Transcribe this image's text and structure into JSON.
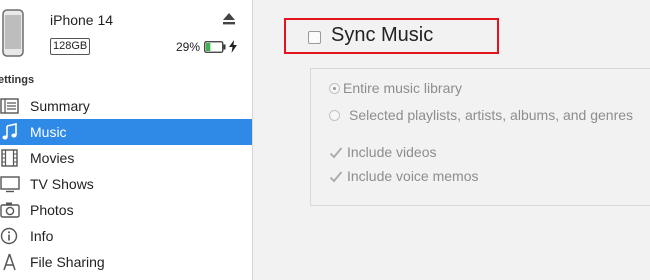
{
  "device": {
    "name": "iPhone 14",
    "capacity": "128GB",
    "battery_percent": "29%",
    "battery_level": 0.29,
    "battery_color": "#3cb44b"
  },
  "sidebar": {
    "heading": "ettings",
    "items": [
      {
        "label": "Summary",
        "icon": "summary-icon"
      },
      {
        "label": "Music",
        "icon": "music-note-icon",
        "active": true
      },
      {
        "label": "Movies",
        "icon": "film-icon"
      },
      {
        "label": "TV Shows",
        "icon": "tv-icon"
      },
      {
        "label": "Photos",
        "icon": "camera-icon"
      },
      {
        "label": "Info",
        "icon": "info-icon"
      },
      {
        "label": "File Sharing",
        "icon": "file-sharing-icon"
      }
    ]
  },
  "main": {
    "sync_label": "Sync Music",
    "sync_checked": false,
    "options": {
      "entire_library": "Entire music library",
      "selected": "Selected playlists, artists, albums, and genres",
      "include_videos": "Include videos",
      "include_voice_memos": "Include voice memos"
    }
  },
  "colors": {
    "accent": "#2e8ae6",
    "highlight_border": "#e3141b"
  }
}
